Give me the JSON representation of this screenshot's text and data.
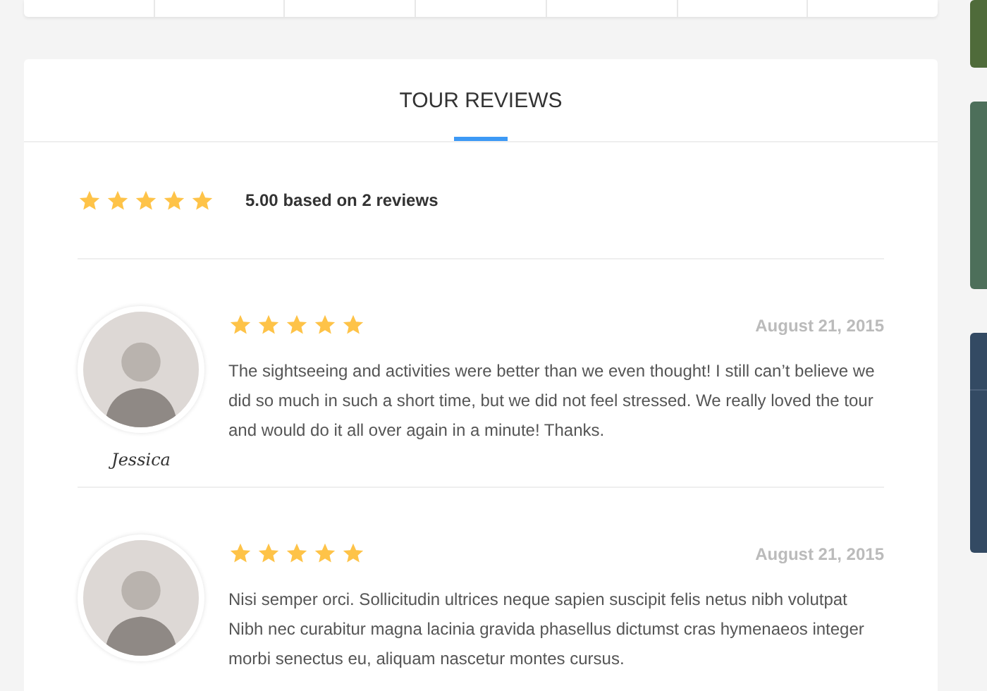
{
  "section": {
    "title": "TOUR REVIEWS"
  },
  "summary": {
    "stars": 5,
    "text": "5.00 based on 2 reviews"
  },
  "reviews": [
    {
      "name": "Jessica",
      "stars": 5,
      "date": "August 21, 2015",
      "text": "The sightseeing and activities were better than we even thought! I still can’t believe we did so much in such a short time, but we did not feel stressed. We really loved the tour and would do it all over again in a minute! Thanks."
    },
    {
      "stars": 5,
      "date": "August 21, 2015",
      "text": "Nisi semper orci. Sollicitudin ultrices neque sapien suscipit felis netus nibh volutpat Nibh nec curabitur magna lacinia gravida phasellus dictumst cras hymenaeos integer morbi senectus eu, aliquam nascetur montes cursus."
    }
  ]
}
